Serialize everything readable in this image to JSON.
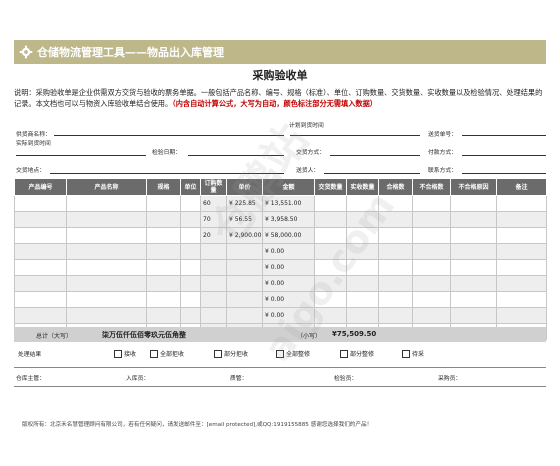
{
  "header": {
    "title": "仓储物流管理工具——物品出入库管理"
  },
  "doc_title": "采购验收单",
  "description": {
    "text": "说明：采购验收单是企业供需双方交货与验收的票务单据。一般包括产品名称、编号、规格（标准）、单位、订购数量、交货数量、实收数量以及检验情况、处理结果的记录。本文档也可以与物资入库验收单结合使用。",
    "highlight": "（内含自动计算公式，大写为自动，颜色标注部分无需填入数据）"
  },
  "info": {
    "plan_date": "计划到货时间",
    "supplier": "供货商名称：",
    "delivery_no": "送货单号：",
    "actual_date": "实际到货时间",
    "inspect_date": "检验日期：",
    "delivery_method": "交货方式：",
    "payment": "付款方式：",
    "location": "交货地点：",
    "sender": "送货人：",
    "contact": "联系方式："
  },
  "table": {
    "headers": [
      "产品编号",
      "产品名称",
      "规格",
      "单位",
      "订购数量",
      "单价",
      "金额",
      "交货数量",
      "实收数量",
      "合格数",
      "不合格数",
      "不合格原因",
      "备注"
    ],
    "rows": [
      {
        "qty": "60",
        "price": "¥ 225.85",
        "amount": "¥ 13,551.00"
      },
      {
        "qty": "70",
        "price": "¥ 56.55",
        "amount": "¥ 3,958.50"
      },
      {
        "qty": "20",
        "price": "¥ 2,900.00",
        "amount": "¥ 58,000.00"
      },
      {
        "qty": "",
        "price": "",
        "amount": "¥ 0.00"
      },
      {
        "qty": "",
        "price": "",
        "amount": "¥ 0.00"
      },
      {
        "qty": "",
        "price": "",
        "amount": "¥ 0.00"
      },
      {
        "qty": "",
        "price": "",
        "amount": "¥ 0.00"
      },
      {
        "qty": "",
        "price": "",
        "amount": "¥ 0.00"
      },
      {
        "qty": "",
        "price": "",
        "amount": "¥ 0.00"
      }
    ]
  },
  "totals": {
    "label_upper": "总计（大写）",
    "upper": "柒万伍仟伍佰零玖元伍角整",
    "label_lower": "（小写）",
    "lower": "¥75,509.50"
  },
  "process": {
    "label": "处理结果",
    "options": [
      "接收",
      "全部拒收",
      "部分拒收",
      "全部整修",
      "部分整修",
      "待采"
    ]
  },
  "sign": {
    "warehouse": "仓库主管：",
    "receiver": "入库员：",
    "quality": "质管：",
    "inspector": "检验员：",
    "buyer": "采购员："
  },
  "footer": "版权所有：北京禾名慧管理顾问有限公司，若有任何疑问，请发送邮件至：[email protected],或QQ:1919155885 感谢您选择我们的产品！",
  "watermark": [
    "仓鹏站",
    "aigo.com"
  ]
}
